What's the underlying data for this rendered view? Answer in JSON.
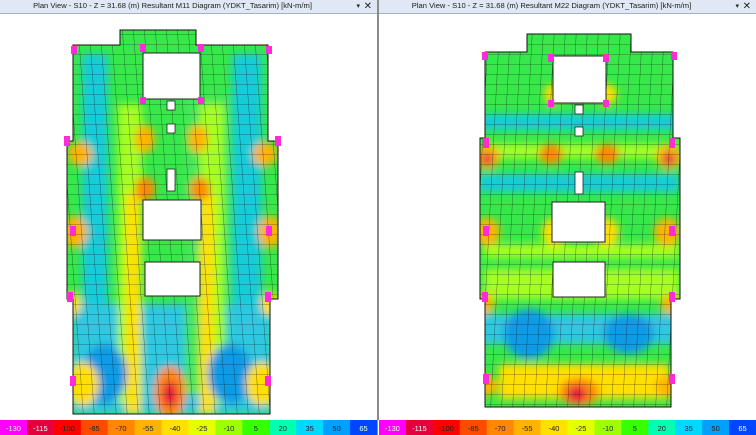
{
  "left_pane": {
    "title": "Plan View - S10 - Z = 31.68 (m)    Resultant M11 Diagram    (YDKT_Tasarim)  [kN-m/m]",
    "dropdown_icon": "chevron-down-icon",
    "close_icon": "close-icon"
  },
  "right_pane": {
    "title": "Plan View - S10 - Z = 31.68 (m)    Resultant M22 Diagram    (YDKT_Tasarim)  [kN-m/m]",
    "dropdown_icon": "chevron-down-icon",
    "close_icon": "close-icon"
  },
  "legend": {
    "values": [
      "-130",
      "-115",
      "-100",
      "-85",
      "-70",
      "-55",
      "-40",
      "-25",
      "-10",
      "5",
      "20",
      "35",
      "50",
      "65"
    ],
    "colors": [
      "#ff00ff",
      "#e3003c",
      "#ff0000",
      "#ff4a00",
      "#ff8800",
      "#ffb300",
      "#ffe000",
      "#e6ff00",
      "#9eff00",
      "#36ff00",
      "#00ffb0",
      "#00d9ff",
      "#00a0ff",
      "#0045ff"
    ]
  }
}
